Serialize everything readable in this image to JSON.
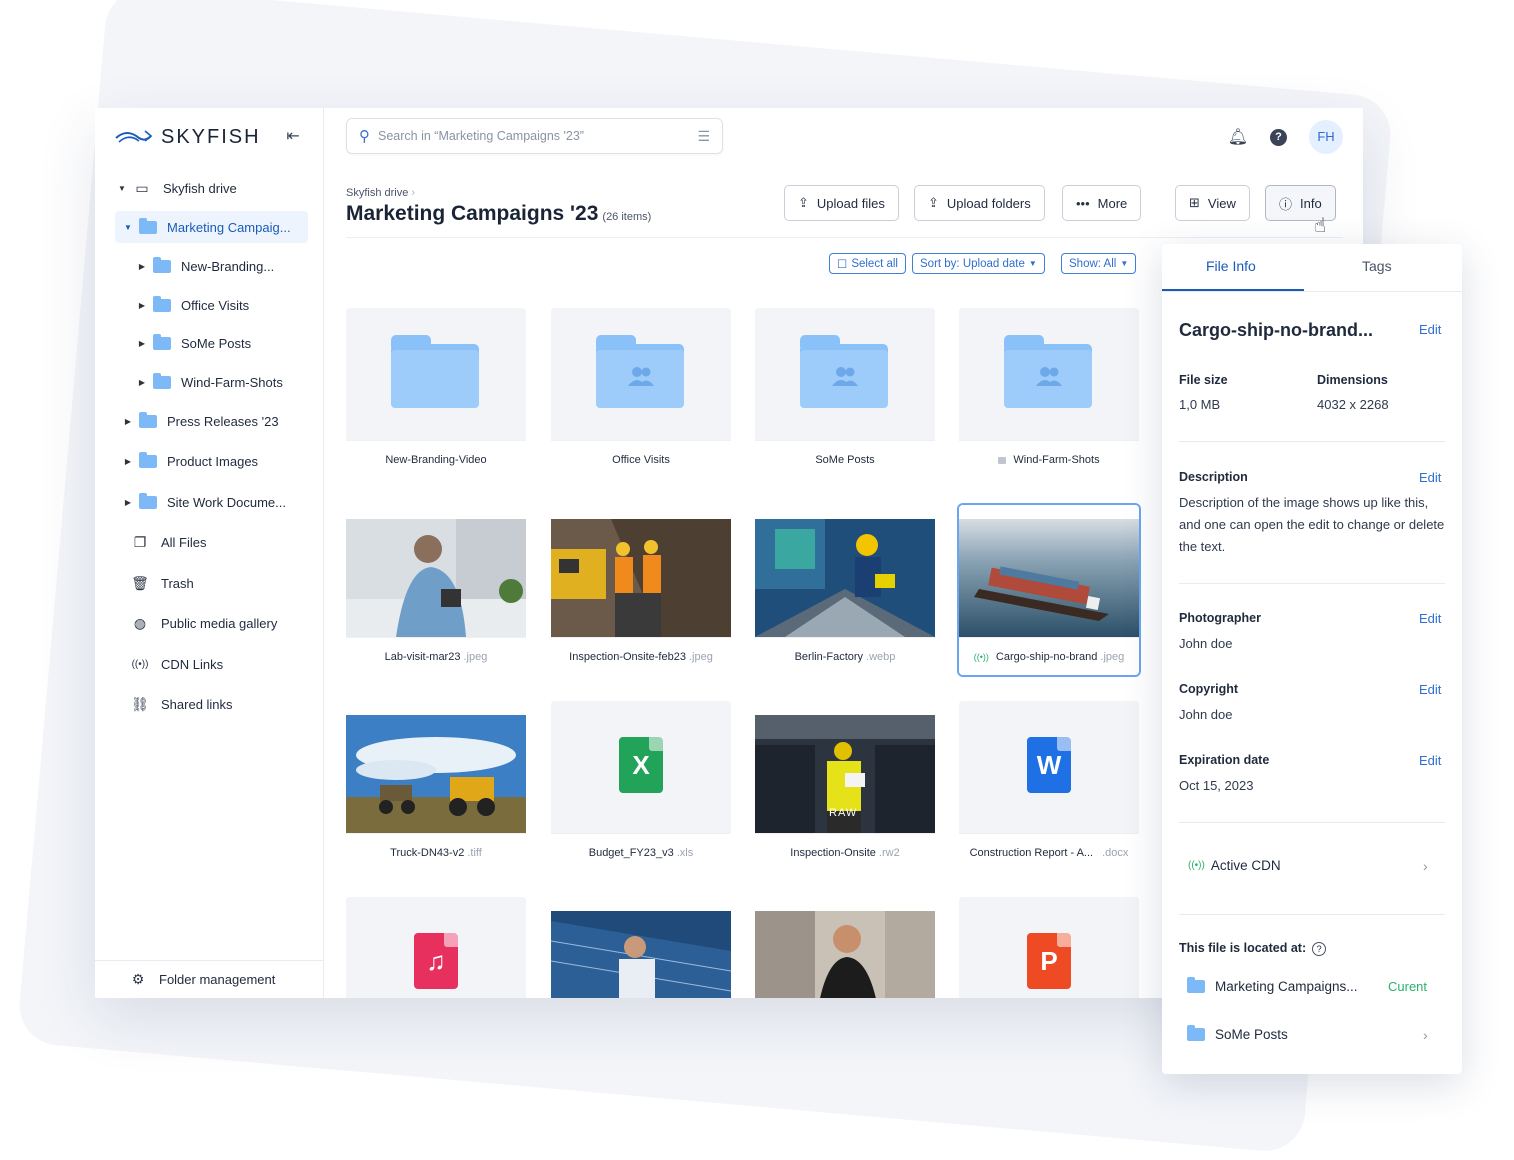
{
  "app": {
    "name": "SKYFISH"
  },
  "sidebar": {
    "tree": [
      {
        "label": "Skyfish drive"
      },
      {
        "label": "Marketing Campaig..."
      },
      {
        "label": "New-Branding..."
      },
      {
        "label": "Office Visits"
      },
      {
        "label": "SoMe Posts"
      },
      {
        "label": "Wind-Farm-Shots"
      },
      {
        "label": "Press Releases '23"
      },
      {
        "label": "Product Images"
      },
      {
        "label": "Site Work Docume..."
      }
    ],
    "nav": [
      {
        "label": "All Files",
        "icon": "files-icon"
      },
      {
        "label": "Trash",
        "icon": "trash-icon"
      },
      {
        "label": "Public media gallery",
        "icon": "globe-icon"
      },
      {
        "label": "CDN Links",
        "icon": "cdn-icon"
      },
      {
        "label": "Shared links",
        "icon": "link-icon"
      }
    ],
    "footer": "Folder management"
  },
  "search": {
    "placeholder": "Search in “Marketing Campaigns '23”"
  },
  "user": {
    "initials": "FH"
  },
  "header": {
    "breadcrumb": "Skyfish drive",
    "title": "Marketing Campaigns '23",
    "count": "(26 items)"
  },
  "toolbar": {
    "upload_files": "Upload files",
    "upload_folders": "Upload folders",
    "more": "More",
    "view": "View",
    "info": "Info"
  },
  "filters": {
    "select_all": "Select all",
    "sort": "Sort by: Upload date",
    "show": "Show: All"
  },
  "grid": {
    "folders": [
      "New-Branding-Video",
      "Office Visits",
      "SoMe Posts",
      "Wind-Farm-Shots"
    ],
    "files": [
      {
        "name": "Lab-visit-mar23",
        "ext": ".jpeg"
      },
      {
        "name": "Inspection-Onsite-feb23",
        "ext": ".jpeg"
      },
      {
        "name": "Berlin-Factory",
        "ext": ".webp"
      },
      {
        "name": "Cargo-ship-no-brand",
        "ext": ".jpeg"
      },
      {
        "name": "Truck-DN43-v2",
        "ext": ".tiff"
      },
      {
        "name": "Budget_FY23_v3",
        "ext": ".xls"
      },
      {
        "name": "Inspection-Onsite",
        "ext": ".rw2"
      },
      {
        "name": "Construction Report - A...",
        "ext": ".docx"
      }
    ],
    "raw_label": "RAW",
    "icon_letters": {
      "xls": "X",
      "doc": "W",
      "ppt": "P",
      "audio": "♫"
    },
    "colors": {
      "xls": "#22a35a",
      "doc": "#1f6fe5",
      "ppt": "#ee4a24",
      "audio": "#e8305f",
      "folder": "#89c1f8"
    }
  },
  "info_panel": {
    "tab_info": "File Info",
    "tab_tags": "Tags",
    "file_name": "Cargo-ship-no-brand...",
    "edit": "Edit",
    "file_size_label": "File size",
    "file_size": "1,0 MB",
    "dimensions_label": "Dimensions",
    "dimensions": "4032 x 2268",
    "description_label": "Description",
    "description": "Description of the image shows up like this, and one can open the edit to change or delete the text.",
    "photographer_label": "Photographer",
    "photographer": "John doe",
    "copyright_label": "Copyright",
    "copyright": "John doe",
    "expiration_label": "Expiration date",
    "expiration": "Oct 15, 2023",
    "cdn": "Active CDN",
    "location_title": "This file is located at:",
    "locations": [
      {
        "label": "Marketing Campaigns...",
        "status": "Curent"
      },
      {
        "label": "SoMe Posts"
      }
    ]
  }
}
